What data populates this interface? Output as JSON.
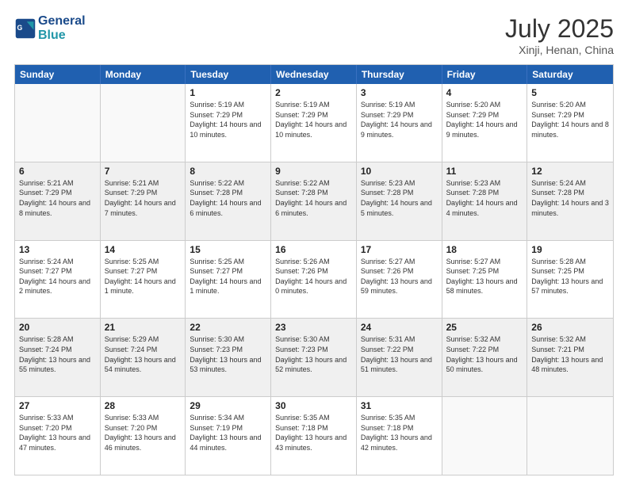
{
  "header": {
    "logo_line1": "General",
    "logo_line2": "Blue",
    "month": "July 2025",
    "location": "Xinji, Henan, China"
  },
  "days_of_week": [
    "Sunday",
    "Monday",
    "Tuesday",
    "Wednesday",
    "Thursday",
    "Friday",
    "Saturday"
  ],
  "weeks": [
    [
      {
        "day": "",
        "info": ""
      },
      {
        "day": "",
        "info": ""
      },
      {
        "day": "1",
        "info": "Sunrise: 5:19 AM\nSunset: 7:29 PM\nDaylight: 14 hours and 10 minutes."
      },
      {
        "day": "2",
        "info": "Sunrise: 5:19 AM\nSunset: 7:29 PM\nDaylight: 14 hours and 10 minutes."
      },
      {
        "day": "3",
        "info": "Sunrise: 5:19 AM\nSunset: 7:29 PM\nDaylight: 14 hours and 9 minutes."
      },
      {
        "day": "4",
        "info": "Sunrise: 5:20 AM\nSunset: 7:29 PM\nDaylight: 14 hours and 9 minutes."
      },
      {
        "day": "5",
        "info": "Sunrise: 5:20 AM\nSunset: 7:29 PM\nDaylight: 14 hours and 8 minutes."
      }
    ],
    [
      {
        "day": "6",
        "info": "Sunrise: 5:21 AM\nSunset: 7:29 PM\nDaylight: 14 hours and 8 minutes."
      },
      {
        "day": "7",
        "info": "Sunrise: 5:21 AM\nSunset: 7:29 PM\nDaylight: 14 hours and 7 minutes."
      },
      {
        "day": "8",
        "info": "Sunrise: 5:22 AM\nSunset: 7:28 PM\nDaylight: 14 hours and 6 minutes."
      },
      {
        "day": "9",
        "info": "Sunrise: 5:22 AM\nSunset: 7:28 PM\nDaylight: 14 hours and 6 minutes."
      },
      {
        "day": "10",
        "info": "Sunrise: 5:23 AM\nSunset: 7:28 PM\nDaylight: 14 hours and 5 minutes."
      },
      {
        "day": "11",
        "info": "Sunrise: 5:23 AM\nSunset: 7:28 PM\nDaylight: 14 hours and 4 minutes."
      },
      {
        "day": "12",
        "info": "Sunrise: 5:24 AM\nSunset: 7:28 PM\nDaylight: 14 hours and 3 minutes."
      }
    ],
    [
      {
        "day": "13",
        "info": "Sunrise: 5:24 AM\nSunset: 7:27 PM\nDaylight: 14 hours and 2 minutes."
      },
      {
        "day": "14",
        "info": "Sunrise: 5:25 AM\nSunset: 7:27 PM\nDaylight: 14 hours and 1 minute."
      },
      {
        "day": "15",
        "info": "Sunrise: 5:25 AM\nSunset: 7:27 PM\nDaylight: 14 hours and 1 minute."
      },
      {
        "day": "16",
        "info": "Sunrise: 5:26 AM\nSunset: 7:26 PM\nDaylight: 14 hours and 0 minutes."
      },
      {
        "day": "17",
        "info": "Sunrise: 5:27 AM\nSunset: 7:26 PM\nDaylight: 13 hours and 59 minutes."
      },
      {
        "day": "18",
        "info": "Sunrise: 5:27 AM\nSunset: 7:25 PM\nDaylight: 13 hours and 58 minutes."
      },
      {
        "day": "19",
        "info": "Sunrise: 5:28 AM\nSunset: 7:25 PM\nDaylight: 13 hours and 57 minutes."
      }
    ],
    [
      {
        "day": "20",
        "info": "Sunrise: 5:28 AM\nSunset: 7:24 PM\nDaylight: 13 hours and 55 minutes."
      },
      {
        "day": "21",
        "info": "Sunrise: 5:29 AM\nSunset: 7:24 PM\nDaylight: 13 hours and 54 minutes."
      },
      {
        "day": "22",
        "info": "Sunrise: 5:30 AM\nSunset: 7:23 PM\nDaylight: 13 hours and 53 minutes."
      },
      {
        "day": "23",
        "info": "Sunrise: 5:30 AM\nSunset: 7:23 PM\nDaylight: 13 hours and 52 minutes."
      },
      {
        "day": "24",
        "info": "Sunrise: 5:31 AM\nSunset: 7:22 PM\nDaylight: 13 hours and 51 minutes."
      },
      {
        "day": "25",
        "info": "Sunrise: 5:32 AM\nSunset: 7:22 PM\nDaylight: 13 hours and 50 minutes."
      },
      {
        "day": "26",
        "info": "Sunrise: 5:32 AM\nSunset: 7:21 PM\nDaylight: 13 hours and 48 minutes."
      }
    ],
    [
      {
        "day": "27",
        "info": "Sunrise: 5:33 AM\nSunset: 7:20 PM\nDaylight: 13 hours and 47 minutes."
      },
      {
        "day": "28",
        "info": "Sunrise: 5:33 AM\nSunset: 7:20 PM\nDaylight: 13 hours and 46 minutes."
      },
      {
        "day": "29",
        "info": "Sunrise: 5:34 AM\nSunset: 7:19 PM\nDaylight: 13 hours and 44 minutes."
      },
      {
        "day": "30",
        "info": "Sunrise: 5:35 AM\nSunset: 7:18 PM\nDaylight: 13 hours and 43 minutes."
      },
      {
        "day": "31",
        "info": "Sunrise: 5:35 AM\nSunset: 7:18 PM\nDaylight: 13 hours and 42 minutes."
      },
      {
        "day": "",
        "info": ""
      },
      {
        "day": "",
        "info": ""
      }
    ]
  ]
}
